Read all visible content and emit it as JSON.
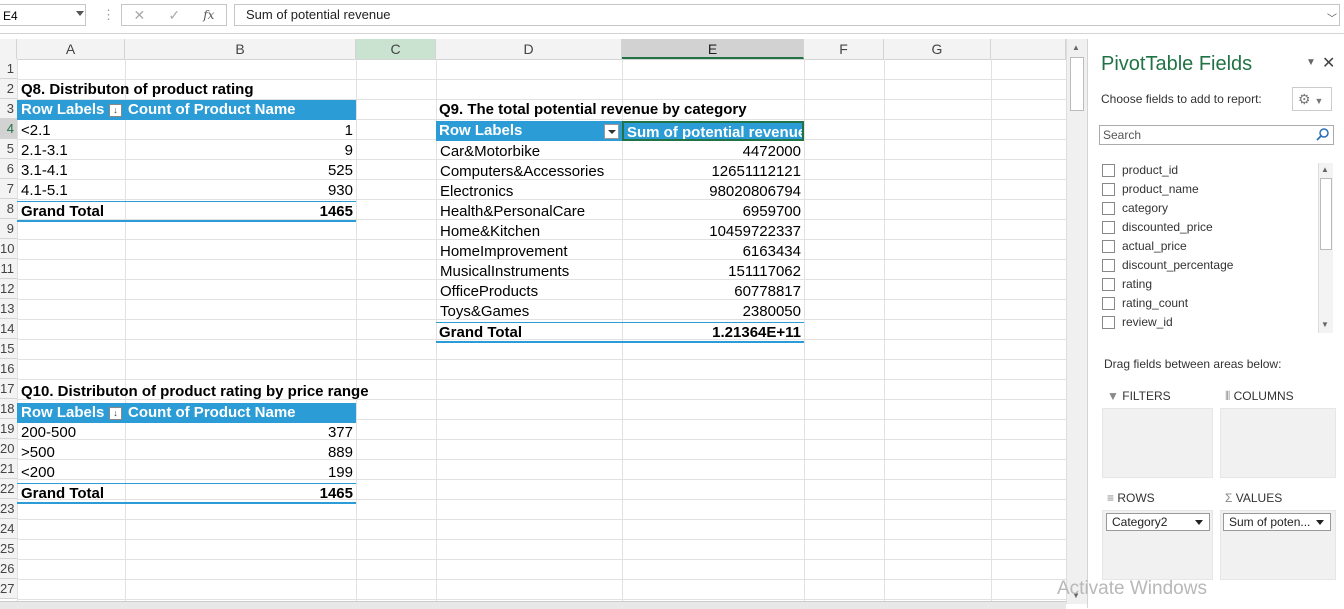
{
  "formula_bar": {
    "name_box": "E4",
    "fx": "fx",
    "formula": "Sum of potential revenue",
    "cancel": "✕",
    "enter": "✓"
  },
  "columns": [
    "A",
    "B",
    "C",
    "D",
    "E",
    "F",
    "G"
  ],
  "rows": [
    "1",
    "2",
    "3",
    "4",
    "5",
    "6",
    "7",
    "8",
    "9",
    "10",
    "11",
    "12",
    "13",
    "14",
    "15",
    "16",
    "17",
    "18",
    "19",
    "20",
    "21",
    "22",
    "23",
    "24",
    "25",
    "26",
    "27"
  ],
  "q8": {
    "title": "Q8. Distributon of product rating",
    "header_row_labels": "Row Labels",
    "header_value": "Count of Product Name",
    "rows": [
      {
        "label": "<2.1",
        "value": "1"
      },
      {
        "label": "2.1-3.1",
        "value": "9"
      },
      {
        "label": "3.1-4.1",
        "value": "525"
      },
      {
        "label": "4.1-5.1",
        "value": "930"
      }
    ],
    "total_label": "Grand Total",
    "total_value": "1465"
  },
  "q9": {
    "title": "Q9. The total potential revenue by category",
    "header_row_labels": "Row Labels",
    "header_value": "Sum of potential revenue",
    "rows": [
      {
        "label": "Car&Motorbike",
        "value": "4472000"
      },
      {
        "label": "Computers&Accessories",
        "value": "12651112121"
      },
      {
        "label": "Electronics",
        "value": "98020806794"
      },
      {
        "label": "Health&PersonalCare",
        "value": "6959700"
      },
      {
        "label": "Home&Kitchen",
        "value": "10459722337"
      },
      {
        "label": "HomeImprovement",
        "value": "6163434"
      },
      {
        "label": "MusicalInstruments",
        "value": "151117062"
      },
      {
        "label": "OfficeProducts",
        "value": "60778817"
      },
      {
        "label": "Toys&Games",
        "value": "2380050"
      }
    ],
    "total_label": "Grand Total",
    "total_value": "1.21364E+11"
  },
  "q10": {
    "title": "Q10. Distributon of product rating by price range",
    "header_row_labels": "Row Labels",
    "header_value": "Count of Product Name",
    "rows": [
      {
        "label": "200-500",
        "value": "377"
      },
      {
        "label": ">500",
        "value": "889"
      },
      {
        "label": "<200",
        "value": "199"
      }
    ],
    "total_label": "Grand Total",
    "total_value": "1465"
  },
  "pivot_pane": {
    "title": "PivotTable Fields",
    "choose_label": "Choose fields to add to report:",
    "search_placeholder": "Search",
    "fields": [
      "product_id",
      "product_name",
      "category",
      "discounted_price",
      "actual_price",
      "discount_percentage",
      "rating",
      "rating_count",
      "review_id"
    ],
    "drag_label": "Drag fields between areas below:",
    "filters_label": "FILTERS",
    "columns_label": "COLUMNS",
    "rows_label": "ROWS",
    "values_label": "VALUES",
    "rows_item": "Category2",
    "values_item": "Sum of poten..."
  },
  "watermark": "Activate Windows",
  "colors": {
    "pivot_header": "#2c9cd6",
    "excel_green": "#217346"
  }
}
